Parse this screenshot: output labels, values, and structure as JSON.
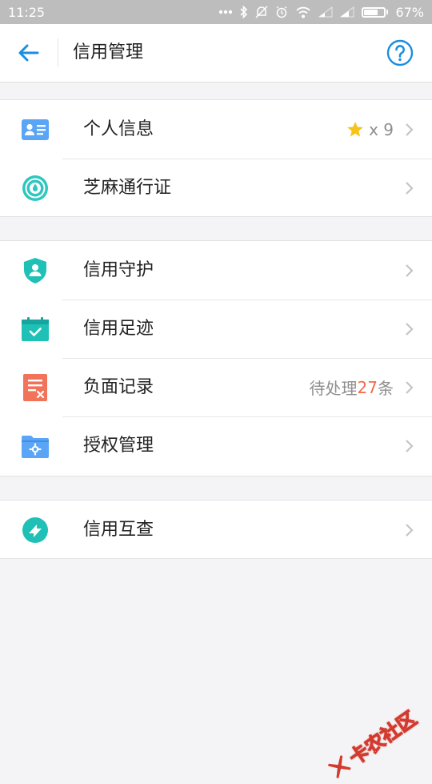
{
  "status_bar": {
    "time": "11:25",
    "battery": "67%",
    "battery_level": 0.67,
    "icons": [
      "more-dots-icon",
      "bluetooth-icon",
      "mute-icon",
      "alarm-icon",
      "wifi-icon",
      "signal-icon",
      "signal-icon",
      "battery-icon"
    ]
  },
  "header": {
    "title": "信用管理",
    "back_icon": "back-arrow-icon",
    "help_icon": "help-icon",
    "accent_color": "#1a8ee1"
  },
  "groups": [
    {
      "items": [
        {
          "label": "个人信息",
          "icon": "id-card-icon",
          "icon_color": "#5aa5f5",
          "right_star": "star-icon",
          "right_text": "x 9"
        },
        {
          "label": "芝麻通行证",
          "icon": "sesame-passport-icon",
          "icon_color": "#2ec7bf"
        }
      ]
    },
    {
      "items": [
        {
          "label": "信用守护",
          "icon": "shield-user-icon",
          "icon_color": "#1fc0b6"
        },
        {
          "label": "信用足迹",
          "icon": "calendar-check-icon",
          "icon_color": "#1fc0b6"
        },
        {
          "label": "负面记录",
          "icon": "negative-record-icon",
          "icon_color": "#f0735a",
          "right_prefix": "待处理",
          "right_count": "27",
          "right_suffix": "条",
          "count_color": "#f26b4b"
        },
        {
          "label": "授权管理",
          "icon": "folder-settings-icon",
          "icon_color": "#5aa5f5"
        }
      ]
    },
    {
      "items": [
        {
          "label": "信用互查",
          "icon": "mutual-check-icon",
          "icon_color": "#1fc0b6"
        }
      ]
    }
  ],
  "watermark": {
    "text": "卡农社区",
    "color": "#d23a2e"
  }
}
